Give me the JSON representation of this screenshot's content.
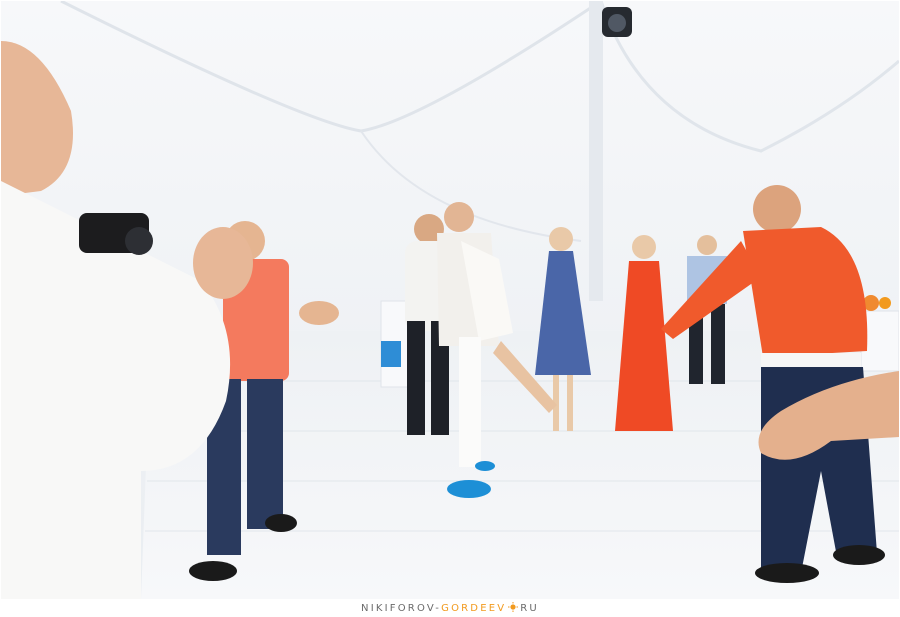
{
  "photo": {
    "subject": "wedding celebration dance in white tent",
    "colors": {
      "tent": "#f3f5f8",
      "floor": "#eef1f4",
      "orange": "#f05a2c",
      "coral": "#f47a5e",
      "navy": "#1f2e4f",
      "blue_accent": "#1d8fd6"
    }
  },
  "watermark": {
    "part1": "NIKIFOROV-",
    "part2": "GORDEEV",
    "part3": "RU",
    "sun_icon": "sun-icon",
    "accent": "#f29a1e"
  }
}
